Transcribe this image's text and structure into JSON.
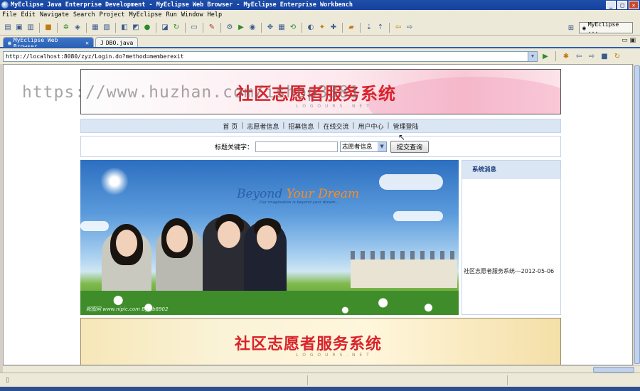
{
  "window": {
    "title": "MyEclipse Java Enterprise Development - MyEclipse Web Browser - MyEclipse Enterprise Workbench",
    "controls": [
      "_",
      "□",
      "✕"
    ]
  },
  "menu": [
    "File",
    "Edit",
    "Navigate",
    "Search",
    "Project",
    "MyEclipse",
    "Run",
    "Window",
    "Help"
  ],
  "toolbar": {
    "perspective_label": "MyEclipse ..."
  },
  "tabs": [
    {
      "label": "MyEclipse Web Browser",
      "active": true
    },
    {
      "label": "DBO.java",
      "active": false
    }
  ],
  "address": {
    "url": "http://localhost:8080/zyz/Login.do?method=memberexit"
  },
  "watermark": "https://www.huzhan.com/ishop3381",
  "site": {
    "banner_title": "社区志愿者服务系统",
    "banner_sub": "L O G O U R S . N E T",
    "nav": [
      "首 页",
      "志愿者信息",
      "招募信息",
      "在线交流",
      "用户中心",
      "管理登陆"
    ],
    "search": {
      "label": "标题关键字：",
      "input_value": "",
      "select_value": "志愿者信息",
      "submit": "提交查询"
    },
    "hero": {
      "headline_a": "Beyond ",
      "headline_b": "Your Dream",
      "subline": "Our imagination is beyond your dream...",
      "credit": "昵图网 www.nipic.com  By:zb8902"
    },
    "sidebar": {
      "title": "系统消息",
      "message": "社区志愿者服务系统---2012-05-06"
    },
    "footer_title": "社区志愿者服务系统",
    "footer_sub": "L O G O U R S . N E T"
  }
}
